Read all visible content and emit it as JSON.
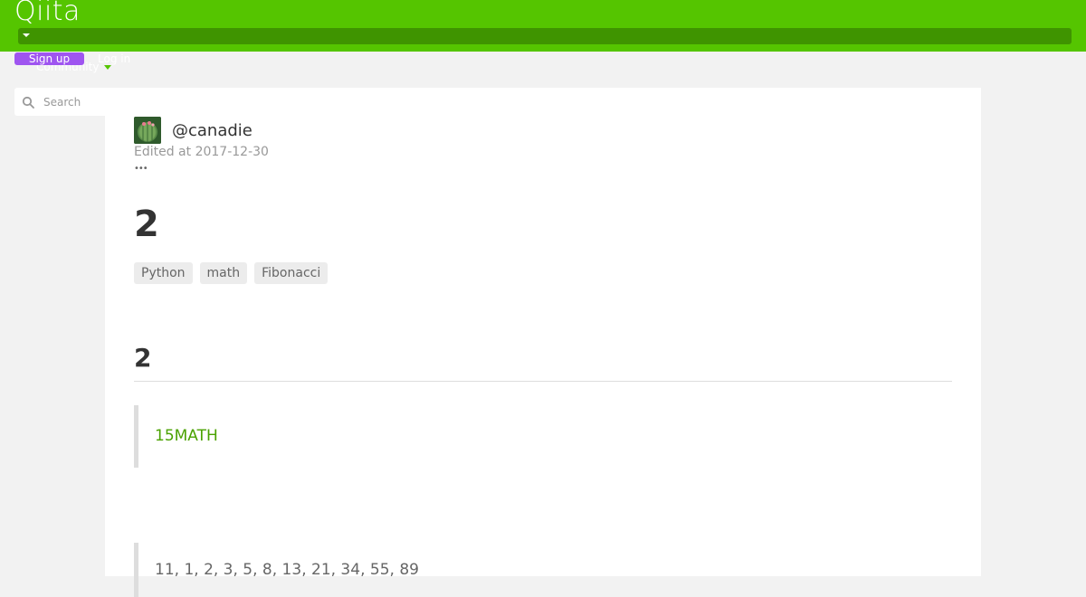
{
  "header": {
    "logo": "Qiita",
    "community_label": "Community",
    "signup_label": "Sign up",
    "login_label": "Log in"
  },
  "search": {
    "placeholder": "Search"
  },
  "article": {
    "author": "@canadie",
    "edited": "Edited at 2017-12-30",
    "more": "•••",
    "title": "2",
    "tags": [
      "Python",
      "math",
      "Fibonacci"
    ],
    "section_heading": "2",
    "quote_link": "15MATH",
    "sequence_text": "11, 1, 2, 3, 5, 8, 13, 21, 34, 55, 89"
  },
  "colors": {
    "brand_green": "#55c500",
    "dropbar_green": "#3f9400",
    "signup_purple": "#9f55f0",
    "link_green": "#4aa200"
  }
}
